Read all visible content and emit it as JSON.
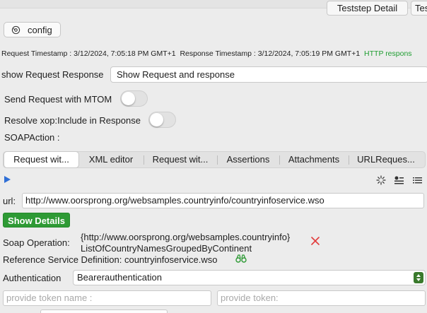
{
  "top_tabs": [
    {
      "label": "Teststep Detail"
    },
    {
      "label": "Testst"
    }
  ],
  "config_button": {
    "label": "config",
    "icon": "gear-icon"
  },
  "timestamps": {
    "request": "Request Timestamp : 3/12/2024, 7:05:18 PM GMT+1",
    "response": "Response Timestamp : 3/12/2024, 7:05:19 PM GMT+1",
    "status": "HTTP respons",
    "status_color": "#1f9d31"
  },
  "show_request_response": {
    "label": "show Request Response",
    "value": "Show Request and response"
  },
  "mtom": {
    "label": "Send Request with MTOM",
    "on": false
  },
  "xop": {
    "label": "Resolve xop:Include in Response",
    "on": false
  },
  "soap_action": {
    "label": "SOAPAction :"
  },
  "tabs": [
    {
      "label": "Request wit...",
      "active": true
    },
    {
      "label": "XML editor",
      "active": false
    },
    {
      "label": "Request wit...",
      "active": false
    },
    {
      "label": "Assertions",
      "active": false
    },
    {
      "label": "Attachments",
      "active": false
    },
    {
      "label": "URLReques...",
      "active": false
    }
  ],
  "url": {
    "label": "url:",
    "value": "http://www.oorsprong.org/websamples.countryinfo/countryinfoservice.wso"
  },
  "show_details": {
    "label": "Show Details",
    "color": "#2e9a35"
  },
  "soap_operation": {
    "label": "Soap Operation:",
    "line1": "{http://www.oorsprong.org/websamples.countryinfo}",
    "line2": "ListOfCountryNamesGroupedByContinent"
  },
  "reference_service": {
    "text": "Reference Service Definition: countryinfoservice.wso"
  },
  "authentication": {
    "label": "Authentication",
    "value": "Bearerauthentication"
  },
  "token_name": {
    "placeholder": "provide token name :"
  },
  "token": {
    "placeholder": "provide token:"
  }
}
